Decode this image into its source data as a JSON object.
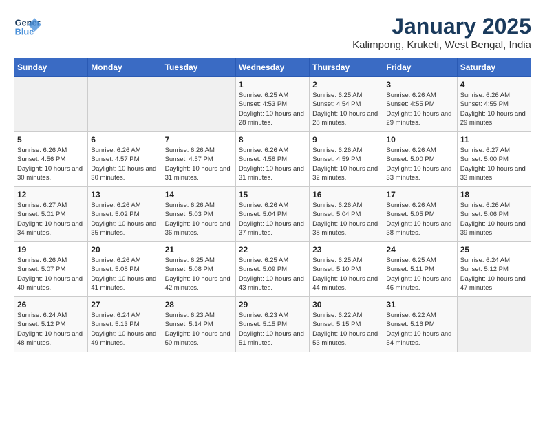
{
  "header": {
    "logo_line1": "General",
    "logo_line2": "Blue",
    "month_title": "January 2025",
    "subtitle": "Kalimpong, Kruketi, West Bengal, India"
  },
  "days_of_week": [
    "Sunday",
    "Monday",
    "Tuesday",
    "Wednesday",
    "Thursday",
    "Friday",
    "Saturday"
  ],
  "weeks": [
    [
      {
        "day": "",
        "sunrise": "",
        "sunset": "",
        "daylight": ""
      },
      {
        "day": "",
        "sunrise": "",
        "sunset": "",
        "daylight": ""
      },
      {
        "day": "",
        "sunrise": "",
        "sunset": "",
        "daylight": ""
      },
      {
        "day": "1",
        "sunrise": "Sunrise: 6:25 AM",
        "sunset": "Sunset: 4:53 PM",
        "daylight": "Daylight: 10 hours and 28 minutes."
      },
      {
        "day": "2",
        "sunrise": "Sunrise: 6:25 AM",
        "sunset": "Sunset: 4:54 PM",
        "daylight": "Daylight: 10 hours and 28 minutes."
      },
      {
        "day": "3",
        "sunrise": "Sunrise: 6:26 AM",
        "sunset": "Sunset: 4:55 PM",
        "daylight": "Daylight: 10 hours and 29 minutes."
      },
      {
        "day": "4",
        "sunrise": "Sunrise: 6:26 AM",
        "sunset": "Sunset: 4:55 PM",
        "daylight": "Daylight: 10 hours and 29 minutes."
      }
    ],
    [
      {
        "day": "5",
        "sunrise": "Sunrise: 6:26 AM",
        "sunset": "Sunset: 4:56 PM",
        "daylight": "Daylight: 10 hours and 30 minutes."
      },
      {
        "day": "6",
        "sunrise": "Sunrise: 6:26 AM",
        "sunset": "Sunset: 4:57 PM",
        "daylight": "Daylight: 10 hours and 30 minutes."
      },
      {
        "day": "7",
        "sunrise": "Sunrise: 6:26 AM",
        "sunset": "Sunset: 4:57 PM",
        "daylight": "Daylight: 10 hours and 31 minutes."
      },
      {
        "day": "8",
        "sunrise": "Sunrise: 6:26 AM",
        "sunset": "Sunset: 4:58 PM",
        "daylight": "Daylight: 10 hours and 31 minutes."
      },
      {
        "day": "9",
        "sunrise": "Sunrise: 6:26 AM",
        "sunset": "Sunset: 4:59 PM",
        "daylight": "Daylight: 10 hours and 32 minutes."
      },
      {
        "day": "10",
        "sunrise": "Sunrise: 6:26 AM",
        "sunset": "Sunset: 5:00 PM",
        "daylight": "Daylight: 10 hours and 33 minutes."
      },
      {
        "day": "11",
        "sunrise": "Sunrise: 6:27 AM",
        "sunset": "Sunset: 5:00 PM",
        "daylight": "Daylight: 10 hours and 33 minutes."
      }
    ],
    [
      {
        "day": "12",
        "sunrise": "Sunrise: 6:27 AM",
        "sunset": "Sunset: 5:01 PM",
        "daylight": "Daylight: 10 hours and 34 minutes."
      },
      {
        "day": "13",
        "sunrise": "Sunrise: 6:26 AM",
        "sunset": "Sunset: 5:02 PM",
        "daylight": "Daylight: 10 hours and 35 minutes."
      },
      {
        "day": "14",
        "sunrise": "Sunrise: 6:26 AM",
        "sunset": "Sunset: 5:03 PM",
        "daylight": "Daylight: 10 hours and 36 minutes."
      },
      {
        "day": "15",
        "sunrise": "Sunrise: 6:26 AM",
        "sunset": "Sunset: 5:04 PM",
        "daylight": "Daylight: 10 hours and 37 minutes."
      },
      {
        "day": "16",
        "sunrise": "Sunrise: 6:26 AM",
        "sunset": "Sunset: 5:04 PM",
        "daylight": "Daylight: 10 hours and 38 minutes."
      },
      {
        "day": "17",
        "sunrise": "Sunrise: 6:26 AM",
        "sunset": "Sunset: 5:05 PM",
        "daylight": "Daylight: 10 hours and 38 minutes."
      },
      {
        "day": "18",
        "sunrise": "Sunrise: 6:26 AM",
        "sunset": "Sunset: 5:06 PM",
        "daylight": "Daylight: 10 hours and 39 minutes."
      }
    ],
    [
      {
        "day": "19",
        "sunrise": "Sunrise: 6:26 AM",
        "sunset": "Sunset: 5:07 PM",
        "daylight": "Daylight: 10 hours and 40 minutes."
      },
      {
        "day": "20",
        "sunrise": "Sunrise: 6:26 AM",
        "sunset": "Sunset: 5:08 PM",
        "daylight": "Daylight: 10 hours and 41 minutes."
      },
      {
        "day": "21",
        "sunrise": "Sunrise: 6:25 AM",
        "sunset": "Sunset: 5:08 PM",
        "daylight": "Daylight: 10 hours and 42 minutes."
      },
      {
        "day": "22",
        "sunrise": "Sunrise: 6:25 AM",
        "sunset": "Sunset: 5:09 PM",
        "daylight": "Daylight: 10 hours and 43 minutes."
      },
      {
        "day": "23",
        "sunrise": "Sunrise: 6:25 AM",
        "sunset": "Sunset: 5:10 PM",
        "daylight": "Daylight: 10 hours and 44 minutes."
      },
      {
        "day": "24",
        "sunrise": "Sunrise: 6:25 AM",
        "sunset": "Sunset: 5:11 PM",
        "daylight": "Daylight: 10 hours and 46 minutes."
      },
      {
        "day": "25",
        "sunrise": "Sunrise: 6:24 AM",
        "sunset": "Sunset: 5:12 PM",
        "daylight": "Daylight: 10 hours and 47 minutes."
      }
    ],
    [
      {
        "day": "26",
        "sunrise": "Sunrise: 6:24 AM",
        "sunset": "Sunset: 5:12 PM",
        "daylight": "Daylight: 10 hours and 48 minutes."
      },
      {
        "day": "27",
        "sunrise": "Sunrise: 6:24 AM",
        "sunset": "Sunset: 5:13 PM",
        "daylight": "Daylight: 10 hours and 49 minutes."
      },
      {
        "day": "28",
        "sunrise": "Sunrise: 6:23 AM",
        "sunset": "Sunset: 5:14 PM",
        "daylight": "Daylight: 10 hours and 50 minutes."
      },
      {
        "day": "29",
        "sunrise": "Sunrise: 6:23 AM",
        "sunset": "Sunset: 5:15 PM",
        "daylight": "Daylight: 10 hours and 51 minutes."
      },
      {
        "day": "30",
        "sunrise": "Sunrise: 6:22 AM",
        "sunset": "Sunset: 5:15 PM",
        "daylight": "Daylight: 10 hours and 53 minutes."
      },
      {
        "day": "31",
        "sunrise": "Sunrise: 6:22 AM",
        "sunset": "Sunset: 5:16 PM",
        "daylight": "Daylight: 10 hours and 54 minutes."
      },
      {
        "day": "",
        "sunrise": "",
        "sunset": "",
        "daylight": ""
      }
    ]
  ]
}
